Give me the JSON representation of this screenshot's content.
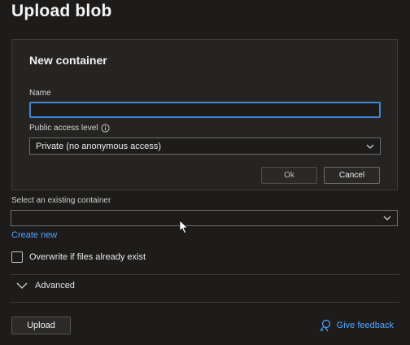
{
  "blade": {
    "title": "Upload blob",
    "select_label": "Select an existing container",
    "create_new": "Create new",
    "overwrite_label": "Overwrite if files already exist",
    "advanced_label": "Advanced",
    "upload_label": "Upload",
    "feedback_label": "Give feedback"
  },
  "modal": {
    "title": "New container",
    "name_label": "Name",
    "name_value": "",
    "access_label": "Public access level",
    "access_value": "Private (no anonymous access)",
    "ok_label": "Ok",
    "cancel_label": "Cancel"
  },
  "colors": {
    "link": "#4fa3ff",
    "focus_border": "#3d87d6",
    "background": "#1d1c1b"
  },
  "icons": {
    "info": "info-icon",
    "chevron": "chevron-down-icon",
    "feedback": "feedback-icon"
  }
}
